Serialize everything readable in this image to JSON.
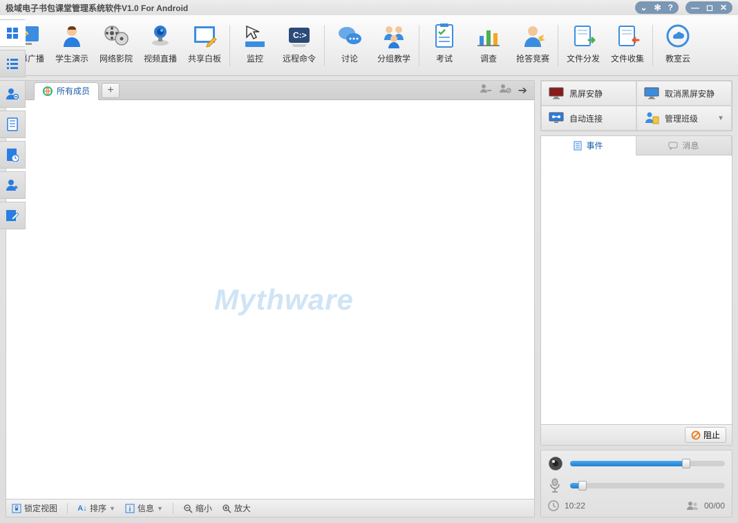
{
  "title": "极域电子书包课堂管理系统软件V1.0 For Android",
  "toolbar": [
    {
      "id": "screen-broadcast",
      "label": "屏幕广播"
    },
    {
      "id": "student-demo",
      "label": "学生演示"
    },
    {
      "id": "network-cinema",
      "label": "网络影院"
    },
    {
      "id": "live-video",
      "label": "视频直播"
    },
    {
      "id": "shared-whiteboard",
      "label": "共享白板"
    },
    {
      "id": "monitor",
      "label": "监控"
    },
    {
      "id": "remote-command",
      "label": "远程命令"
    },
    {
      "id": "discussion",
      "label": "讨论"
    },
    {
      "id": "group-teaching",
      "label": "分组教学"
    },
    {
      "id": "exam",
      "label": "考试"
    },
    {
      "id": "survey",
      "label": "调查"
    },
    {
      "id": "quiz-compete",
      "label": "抢答竞赛"
    },
    {
      "id": "file-send",
      "label": "文件分发"
    },
    {
      "id": "file-collect",
      "label": "文件收集"
    },
    {
      "id": "classroom-cloud",
      "label": "教室云"
    }
  ],
  "separators_after_index": [
    4,
    6,
    8,
    11,
    13
  ],
  "members_tab": "所有成员",
  "watermark": "Mythware",
  "statusbar": {
    "lockview": "锁定视图",
    "sort": "排序",
    "info": "信息",
    "zoomout": "缩小",
    "zoomin": "放大"
  },
  "quickactions": {
    "black_screen": "黑屏安静",
    "cancel_black": "取消黑屏安静",
    "auto_connect": "自动连接",
    "manage_class": "管理班级"
  },
  "log_tabs": {
    "events": "事件",
    "messages": "消息"
  },
  "stop_label": "阻止",
  "status": {
    "time": "10:22",
    "users": "00/00"
  },
  "sliders": {
    "speaker_pct": 75,
    "mic_pct": 8
  }
}
